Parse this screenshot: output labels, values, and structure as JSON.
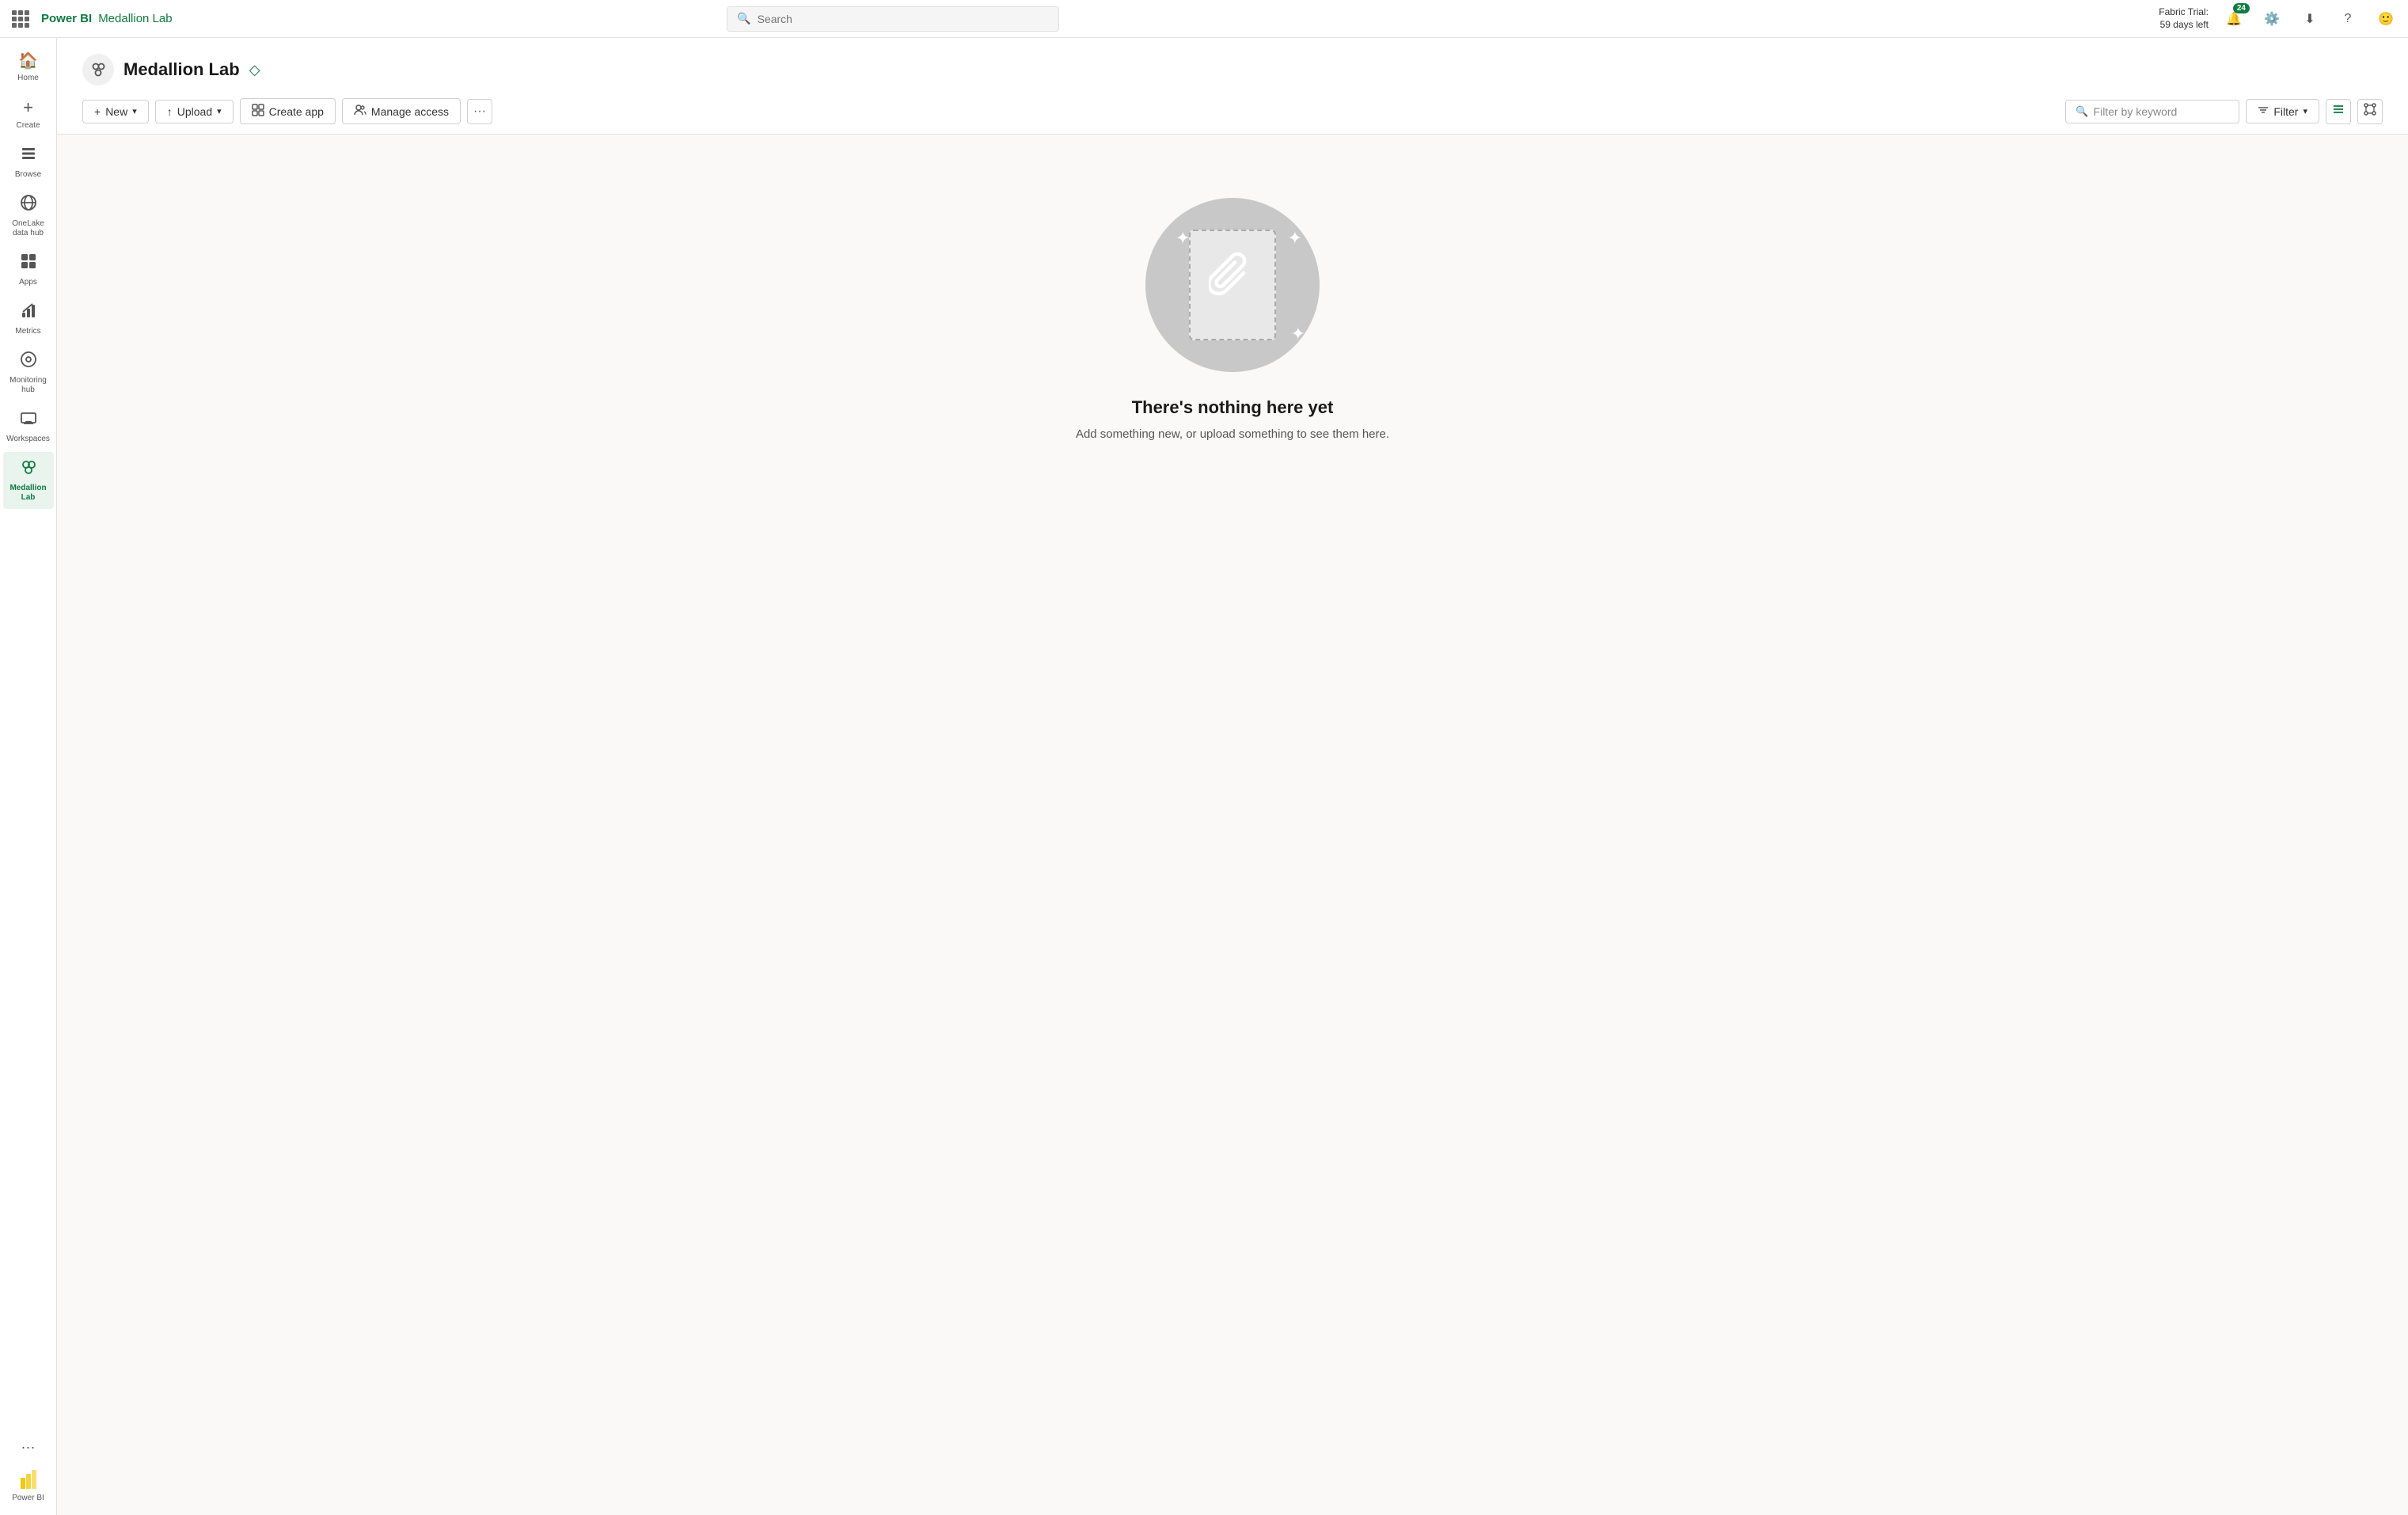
{
  "topbar": {
    "logo_powerbi": "Power BI",
    "logo_separator": "|",
    "logo_workspace": "Medallion Lab",
    "search_placeholder": "Search",
    "fabric_trial_line1": "Fabric Trial:",
    "fabric_trial_line2": "59 days left",
    "notif_badge": "24"
  },
  "sidebar": {
    "items": [
      {
        "id": "home",
        "label": "Home",
        "icon": "🏠"
      },
      {
        "id": "create",
        "label": "Create",
        "icon": "➕"
      },
      {
        "id": "browse",
        "label": "Browse",
        "icon": "📁"
      },
      {
        "id": "onelake",
        "label": "OneLake\ndata hub",
        "icon": "🔵"
      },
      {
        "id": "apps",
        "label": "Apps",
        "icon": "⊞"
      },
      {
        "id": "metrics",
        "label": "Metrics",
        "icon": "📊"
      },
      {
        "id": "monitoring",
        "label": "Monitoring\nhub",
        "icon": "⊙"
      },
      {
        "id": "workspaces",
        "label": "Workspaces",
        "icon": "🖥"
      },
      {
        "id": "medallion",
        "label": "Medallion\nLab",
        "icon": "👥",
        "active": true
      }
    ],
    "more_label": "···",
    "powerbi_label": "Power BI"
  },
  "workspace": {
    "name": "Medallion Lab",
    "icon": "👥"
  },
  "toolbar": {
    "new_label": "New",
    "upload_label": "Upload",
    "create_app_label": "Create app",
    "manage_access_label": "Manage access",
    "more_label": "···",
    "filter_keyword_placeholder": "Filter by keyword",
    "filter_label": "Filter"
  },
  "empty_state": {
    "title": "There's nothing here yet",
    "subtitle": "Add something new, or upload something to see them here."
  }
}
